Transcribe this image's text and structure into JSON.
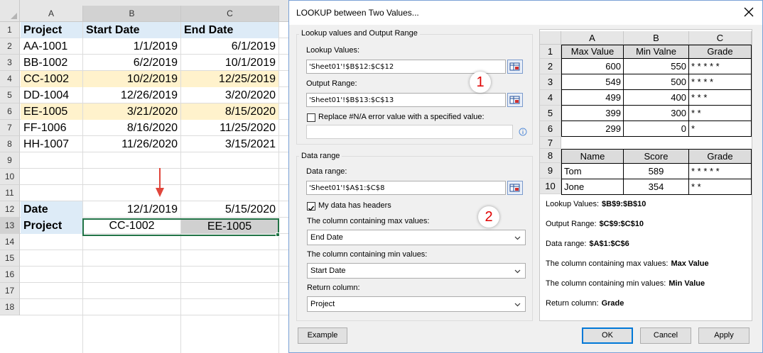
{
  "sheet": {
    "columns": [
      "A",
      "B",
      "C"
    ],
    "rows": [
      "1",
      "2",
      "3",
      "4",
      "5",
      "6",
      "7",
      "8",
      "9",
      "10",
      "11",
      "12",
      "13",
      "14",
      "15",
      "16",
      "17",
      "18"
    ],
    "table": {
      "headers": [
        "Project",
        "Start Date",
        "End Date"
      ],
      "data": [
        [
          "AA-1001",
          "1/1/2019",
          "6/1/2019"
        ],
        [
          "BB-1002",
          "6/2/2019",
          "10/1/2019"
        ],
        [
          "CC-1002",
          "10/2/2019",
          "12/25/2019"
        ],
        [
          "DD-1004",
          "12/26/2019",
          "3/20/2020"
        ],
        [
          "EE-1005",
          "3/21/2020",
          "8/15/2020"
        ],
        [
          "FF-1006",
          "8/16/2020",
          "11/25/2020"
        ],
        [
          "HH-1007",
          "11/26/2020",
          "3/15/2021"
        ]
      ]
    },
    "lookup": {
      "date_label": "Date",
      "date_values": [
        "12/1/2019",
        "5/15/2020"
      ],
      "project_label": "Project",
      "project_values": [
        "CC-1002",
        "EE-1005"
      ]
    },
    "colors": {
      "header_fill": "#ddebf7",
      "highlight_fill": "#fff2cc",
      "arrow": "#e0463c",
      "selection": "#217346"
    }
  },
  "dialog": {
    "title": "LOOKUP between Two Values...",
    "group1": {
      "title": "Lookup values and Output Range",
      "lookup_label": "Lookup Values:",
      "lookup_value": "'Sheet01'!$B$12:$C$12",
      "output_label": "Output Range:",
      "output_value": "'Sheet01'!$B$13:$C$13",
      "replace_label": "Replace #N/A error value with a specified value:",
      "replace_value": ""
    },
    "group2": {
      "title": "Data range",
      "range_label": "Data range:",
      "range_value": "'Sheet01'!$A$1:$C$8",
      "headers_label": "My data has headers",
      "max_label": "The column containing max values:",
      "max_value": "End Date",
      "min_label": "The column containing min values:",
      "min_value": "Start Date",
      "return_label": "Return column:",
      "return_value": "Project"
    },
    "badges": [
      "1",
      "2"
    ],
    "buttons": {
      "example": "Example",
      "ok": "OK",
      "cancel": "Cancel",
      "apply": "Apply"
    },
    "preview": {
      "columns": [
        "A",
        "B",
        "C"
      ],
      "rows": [
        "1",
        "2",
        "3",
        "4",
        "5",
        "6",
        "7",
        "8",
        "9",
        "10"
      ],
      "grade_headers": [
        "Max Value",
        "Min Valne",
        "Grade"
      ],
      "grade_data": [
        [
          "600",
          "550",
          "* * * * *"
        ],
        [
          "549",
          "500",
          "* * * *"
        ],
        [
          "499",
          "400",
          "* * *"
        ],
        [
          "399",
          "300",
          "* *"
        ],
        [
          "299",
          "0",
          "*"
        ]
      ],
      "score_headers": [
        "Name",
        "Score",
        "Grade"
      ],
      "score_data": [
        [
          "Tom",
          "589",
          "* * * * *"
        ],
        [
          "Jone",
          "354",
          "* *"
        ]
      ],
      "notes": [
        {
          "label": "Lookup Values:",
          "value": "$B$9:$B$10"
        },
        {
          "label": "Output Range:",
          "value": "$C$9:$C$10"
        },
        {
          "label": "Data range:",
          "value": "$A$1:$C$6"
        },
        {
          "label": "The column containing max values:",
          "value": "Max Value"
        },
        {
          "label": "The column containing min values:",
          "value": "Min Value"
        },
        {
          "label": "Return column:",
          "value": "Grade"
        }
      ]
    }
  }
}
